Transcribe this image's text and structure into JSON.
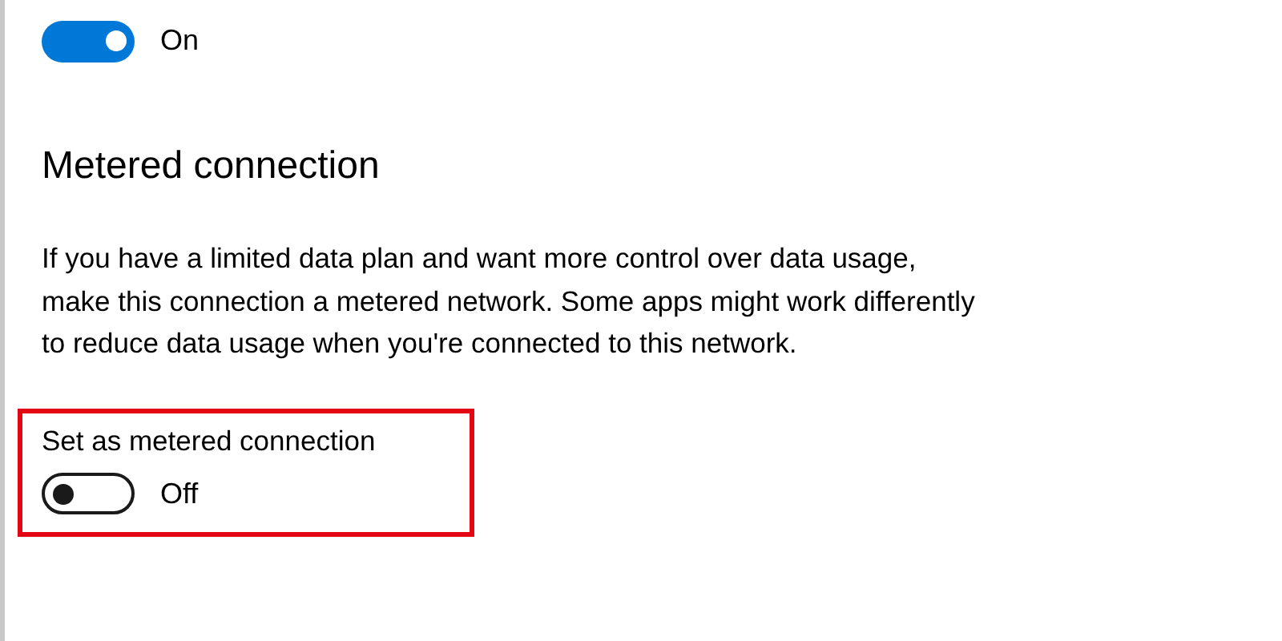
{
  "top_toggle": {
    "on": true,
    "state_text": "On"
  },
  "section": {
    "heading": "Metered connection",
    "description": "If you have a limited data plan and want more control over data usage, make this connection a metered network. Some apps might work differently to reduce data usage when you're connected to this network."
  },
  "metered_setting": {
    "label": "Set as metered connection",
    "on": false,
    "state_text": "Off",
    "highlighted": true
  }
}
